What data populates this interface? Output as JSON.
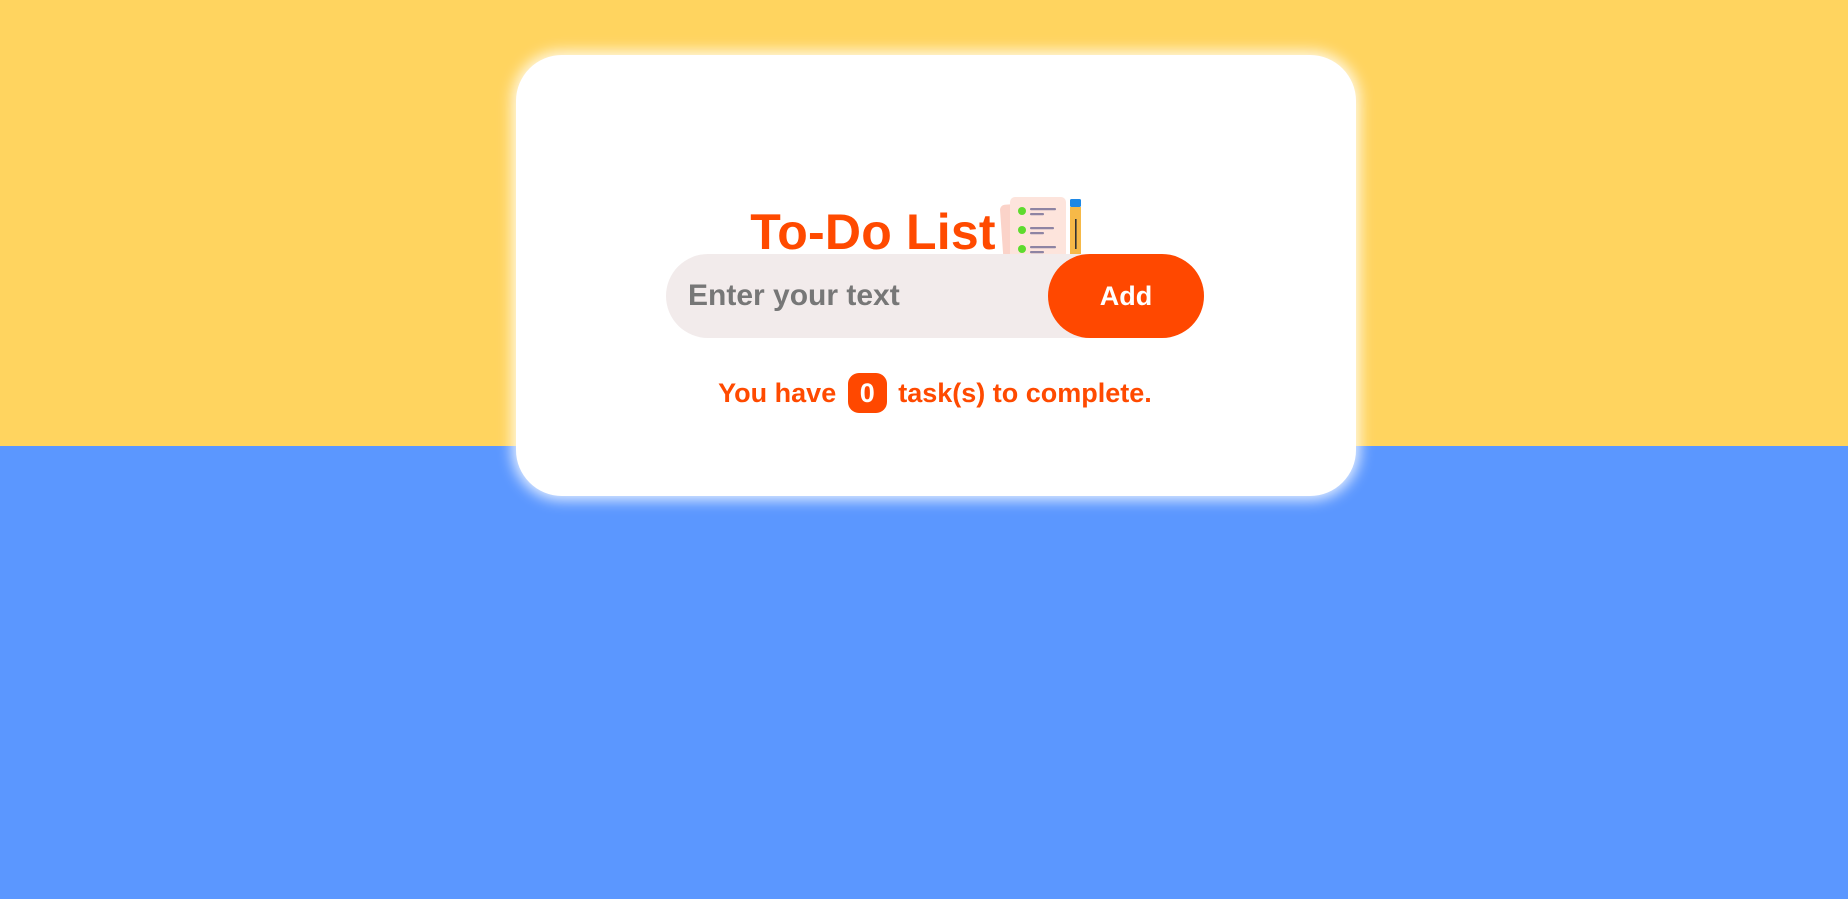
{
  "app": {
    "title": "To-Do List",
    "title_icon": "checklist-with-pencil-icon"
  },
  "input": {
    "placeholder": "Enter your text",
    "value": ""
  },
  "add_button": {
    "label": "Add"
  },
  "status": {
    "prefix": "You have",
    "count": "0",
    "suffix": "task(s) to complete."
  },
  "colors": {
    "background_top": "#FFD45F",
    "background_bottom": "#5B97FF",
    "accent": "#FF4800",
    "input_background": "#F2EBEB",
    "card": "#FFFFFF"
  }
}
